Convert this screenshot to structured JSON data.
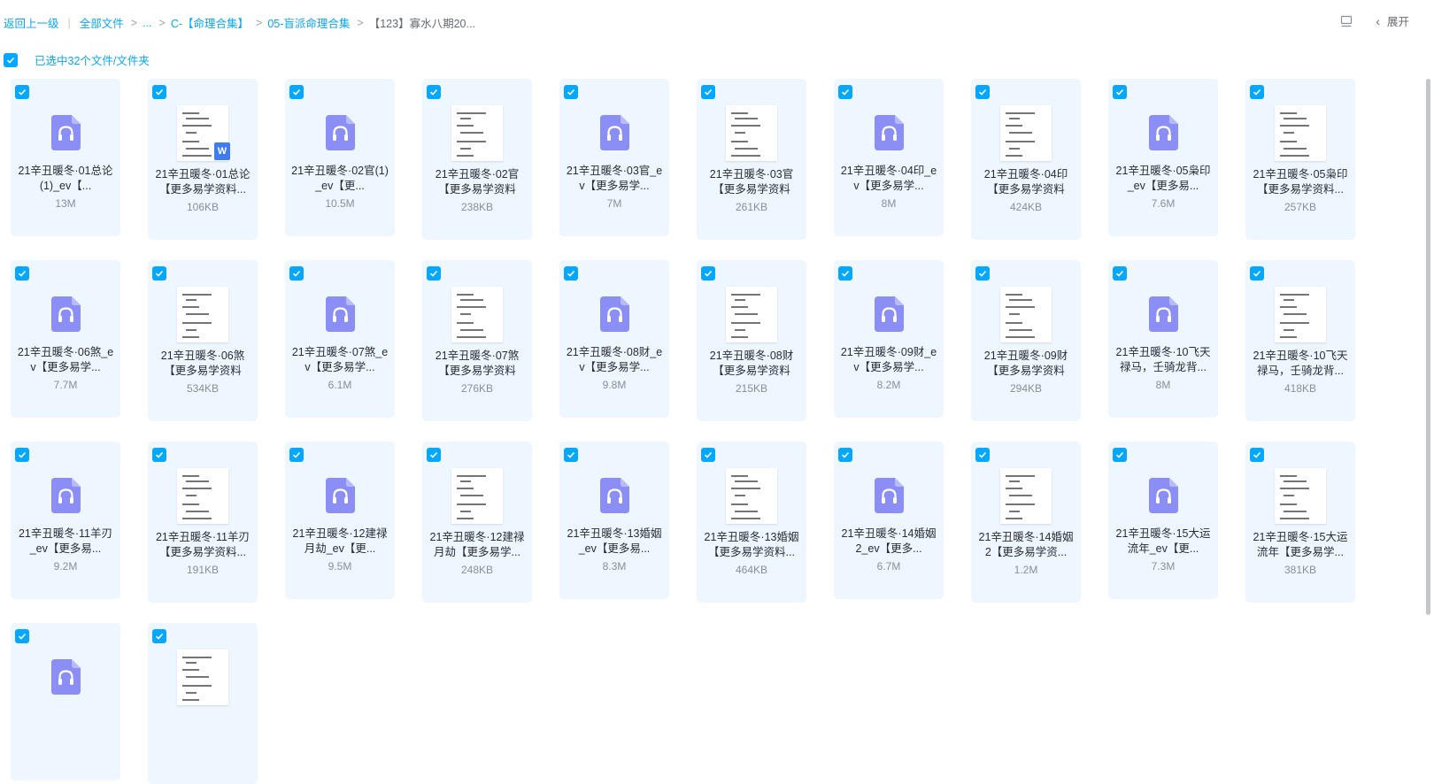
{
  "breadcrumb": {
    "back": "返回上一级",
    "items": [
      "全部文件",
      "...",
      "C-【命理合集】",
      "05-盲派命理合集",
      "【123】寡水八期20..."
    ]
  },
  "toolbar": {
    "expand_label": "展开"
  },
  "selection": {
    "label": "已选中32个文件/文件夹"
  },
  "colors": {
    "accent": "#06a7ff",
    "card_bg": "#eef7ff",
    "audio_icon": "#8b8ef5"
  },
  "files": [
    {
      "type": "audio",
      "name": "21辛丑暖冬·01总论(1)_ev【...",
      "size": "13M"
    },
    {
      "type": "doc",
      "name": "21辛丑暖冬·01总论【更多易学资料...",
      "size": "106KB",
      "badge": "W"
    },
    {
      "type": "audio",
      "name": "21辛丑暖冬·02官(1)_ev【更...",
      "size": "10.5M"
    },
    {
      "type": "doc",
      "name": "21辛丑暖冬·02官【更多易学资料",
      "size": "238KB"
    },
    {
      "type": "audio",
      "name": "21辛丑暖冬·03官_ev【更多易学...",
      "size": "7M"
    },
    {
      "type": "doc",
      "name": "21辛丑暖冬·03官【更多易学资料",
      "size": "261KB"
    },
    {
      "type": "audio",
      "name": "21辛丑暖冬·04印_ev【更多易学...",
      "size": "8M"
    },
    {
      "type": "doc",
      "name": "21辛丑暖冬·04印【更多易学资料",
      "size": "424KB"
    },
    {
      "type": "audio",
      "name": "21辛丑暖冬·05枭印_ev【更多易...",
      "size": "7.6M"
    },
    {
      "type": "doc",
      "name": "21辛丑暖冬·05枭印【更多易学资料...",
      "size": "257KB"
    },
    {
      "type": "audio",
      "name": "21辛丑暖冬·06煞_ev【更多易学...",
      "size": "7.7M"
    },
    {
      "type": "doc",
      "name": "21辛丑暖冬·06煞【更多易学资料",
      "size": "534KB"
    },
    {
      "type": "audio",
      "name": "21辛丑暖冬·07煞_ev【更多易学...",
      "size": "6.1M"
    },
    {
      "type": "doc",
      "name": "21辛丑暖冬·07煞【更多易学资料",
      "size": "276KB"
    },
    {
      "type": "audio",
      "name": "21辛丑暖冬·08财_ev【更多易学...",
      "size": "9.8M"
    },
    {
      "type": "doc",
      "name": "21辛丑暖冬·08财【更多易学资料",
      "size": "215KB"
    },
    {
      "type": "audio",
      "name": "21辛丑暖冬·09财_ev【更多易学...",
      "size": "8.2M"
    },
    {
      "type": "doc",
      "name": "21辛丑暖冬·09财【更多易学资料",
      "size": "294KB"
    },
    {
      "type": "audio",
      "name": "21辛丑暖冬·10飞天禄马，壬骑龙背...",
      "size": "8M"
    },
    {
      "type": "doc",
      "name": "21辛丑暖冬·10飞天禄马，壬骑龙背...",
      "size": "418KB"
    },
    {
      "type": "audio",
      "name": "21辛丑暖冬·11羊刃_ev【更多易...",
      "size": "9.2M"
    },
    {
      "type": "doc",
      "name": "21辛丑暖冬·11羊刃【更多易学资料...",
      "size": "191KB"
    },
    {
      "type": "audio",
      "name": "21辛丑暖冬·12建禄月劫_ev【更...",
      "size": "9.5M"
    },
    {
      "type": "doc",
      "name": "21辛丑暖冬·12建禄月劫【更多易学...",
      "size": "248KB"
    },
    {
      "type": "audio",
      "name": "21辛丑暖冬·13婚姻_ev【更多易...",
      "size": "8.3M"
    },
    {
      "type": "doc",
      "name": "21辛丑暖冬·13婚姻【更多易学资料...",
      "size": "464KB"
    },
    {
      "type": "audio",
      "name": "21辛丑暖冬·14婚姻2_ev【更多...",
      "size": "6.7M"
    },
    {
      "type": "doc",
      "name": "21辛丑暖冬·14婚姻2【更多易学资...",
      "size": "1.2M"
    },
    {
      "type": "audio",
      "name": "21辛丑暖冬·15大运流年_ev【更...",
      "size": "7.3M"
    },
    {
      "type": "doc",
      "name": "21辛丑暖冬·15大运流年【更多易学...",
      "size": "381KB"
    },
    {
      "type": "audio",
      "name": "",
      "size": ""
    },
    {
      "type": "doc",
      "name": "",
      "size": ""
    }
  ]
}
